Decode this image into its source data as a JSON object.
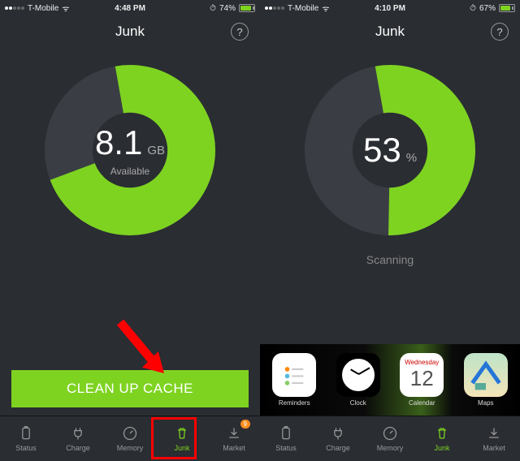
{
  "left": {
    "statusbar": {
      "carrier": "T-Mobile",
      "time": "4:48 PM",
      "battery": "74%",
      "batt_fill": 74
    },
    "title": "Junk",
    "ring": {
      "value": "8.1",
      "unit": "GB",
      "sub": "Available",
      "pct": 72
    },
    "cta_label": "CLEAN UP CACHE",
    "tabs": [
      {
        "label": "Status",
        "icon": "battery"
      },
      {
        "label": "Charge",
        "icon": "plug"
      },
      {
        "label": "Memory",
        "icon": "gauge"
      },
      {
        "label": "Junk",
        "icon": "trash",
        "active": true,
        "highlight": true
      },
      {
        "label": "Market",
        "icon": "download",
        "badge": "9"
      }
    ]
  },
  "right": {
    "statusbar": {
      "carrier": "T-Mobile",
      "time": "4:10 PM",
      "battery": "67%",
      "batt_fill": 67
    },
    "title": "Junk",
    "ring": {
      "value": "53",
      "unit": "%",
      "sub": "",
      "pct": 53
    },
    "scanning": "Scanning",
    "dock": [
      {
        "label": "Reminders",
        "icon": "reminders"
      },
      {
        "label": "Clock",
        "icon": "clock"
      },
      {
        "label": "Calendar",
        "icon": "calendar",
        "weekday": "Wednesday",
        "day": "12"
      },
      {
        "label": "Maps",
        "icon": "maps"
      }
    ],
    "tabs": [
      {
        "label": "Status",
        "icon": "battery"
      },
      {
        "label": "Charge",
        "icon": "plug"
      },
      {
        "label": "Memory",
        "icon": "gauge"
      },
      {
        "label": "Junk",
        "icon": "trash",
        "active": true
      },
      {
        "label": "Market",
        "icon": "download"
      }
    ]
  },
  "colors": {
    "accent": "#7ed321",
    "bg": "#2a2d32"
  }
}
